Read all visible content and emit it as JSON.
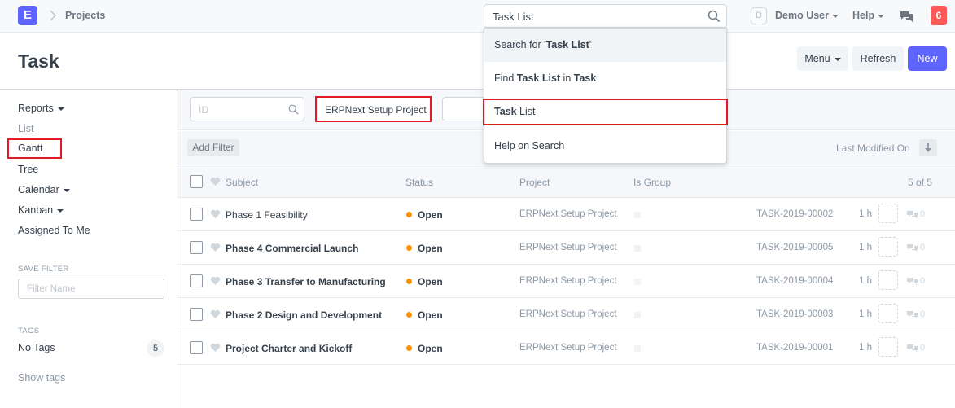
{
  "navbar": {
    "logo": "E",
    "breadcrumb": "Projects",
    "search_value": "Task List",
    "avatar_letter": "D",
    "user_label": "Demo User",
    "help_label": "Help",
    "notification_count": "6"
  },
  "page": {
    "title": "Task",
    "menu_label": "Menu",
    "refresh_label": "Refresh",
    "new_label": "New"
  },
  "sidebar": {
    "items": [
      "Reports",
      "List",
      "Gantt",
      "Tree",
      "Calendar",
      "Kanban",
      "Assigned To Me"
    ],
    "save_filter_label": "SAVE FILTER",
    "filter_name_placeholder": "Filter Name",
    "tags_label": "TAGS",
    "no_tags_label": "No Tags",
    "no_tags_count": "5",
    "show_tags_label": "Show tags"
  },
  "filters": {
    "id_placeholder": "ID",
    "project_value": "ERPNext Setup Project",
    "add_filter_label": "Add Filter",
    "sort_label": "Last Modified On"
  },
  "list": {
    "columns": [
      "Subject",
      "Status",
      "Project",
      "Is Group"
    ],
    "count": "5 of 5",
    "rows": [
      {
        "subject": "Phase 1 Feasibility",
        "status": "Open",
        "project": "ERPNext Setup Project",
        "task_id": "TASK-2019-00002",
        "hours": "1 h",
        "comments": "0"
      },
      {
        "subject": "Phase 4 Commercial Launch",
        "status": "Open",
        "project": "ERPNext Setup Project",
        "task_id": "TASK-2019-00005",
        "hours": "1 h",
        "comments": "0"
      },
      {
        "subject": "Phase 3 Transfer to Manufacturing",
        "status": "Open",
        "project": "ERPNext Setup Project",
        "task_id": "TASK-2019-00004",
        "hours": "1 h",
        "comments": "0"
      },
      {
        "subject": "Phase 2 Design and Development",
        "status": "Open",
        "project": "ERPNext Setup Project",
        "task_id": "TASK-2019-00003",
        "hours": "1 h",
        "comments": "0"
      },
      {
        "subject": "Project Charter and Kickoff",
        "status": "Open",
        "project": "ERPNext Setup Project",
        "task_id": "TASK-2019-00001",
        "hours": "1 h",
        "comments": "0"
      }
    ]
  },
  "search_dropdown": {
    "search_for_prefix": "Search for '",
    "search_for_term": "Task List",
    "search_for_suffix": "'",
    "find_prefix": "Find ",
    "find_term": "Task List",
    "find_mid": " in ",
    "find_doctype": "Task",
    "task_list_bold": "Task",
    "task_list_rest": " List",
    "help_on_search": "Help on Search"
  },
  "colors": {
    "brand": "#5e64ff",
    "notification": "#ff5858",
    "status_open": "#ff9000",
    "highlight_border": "#e01b24"
  }
}
